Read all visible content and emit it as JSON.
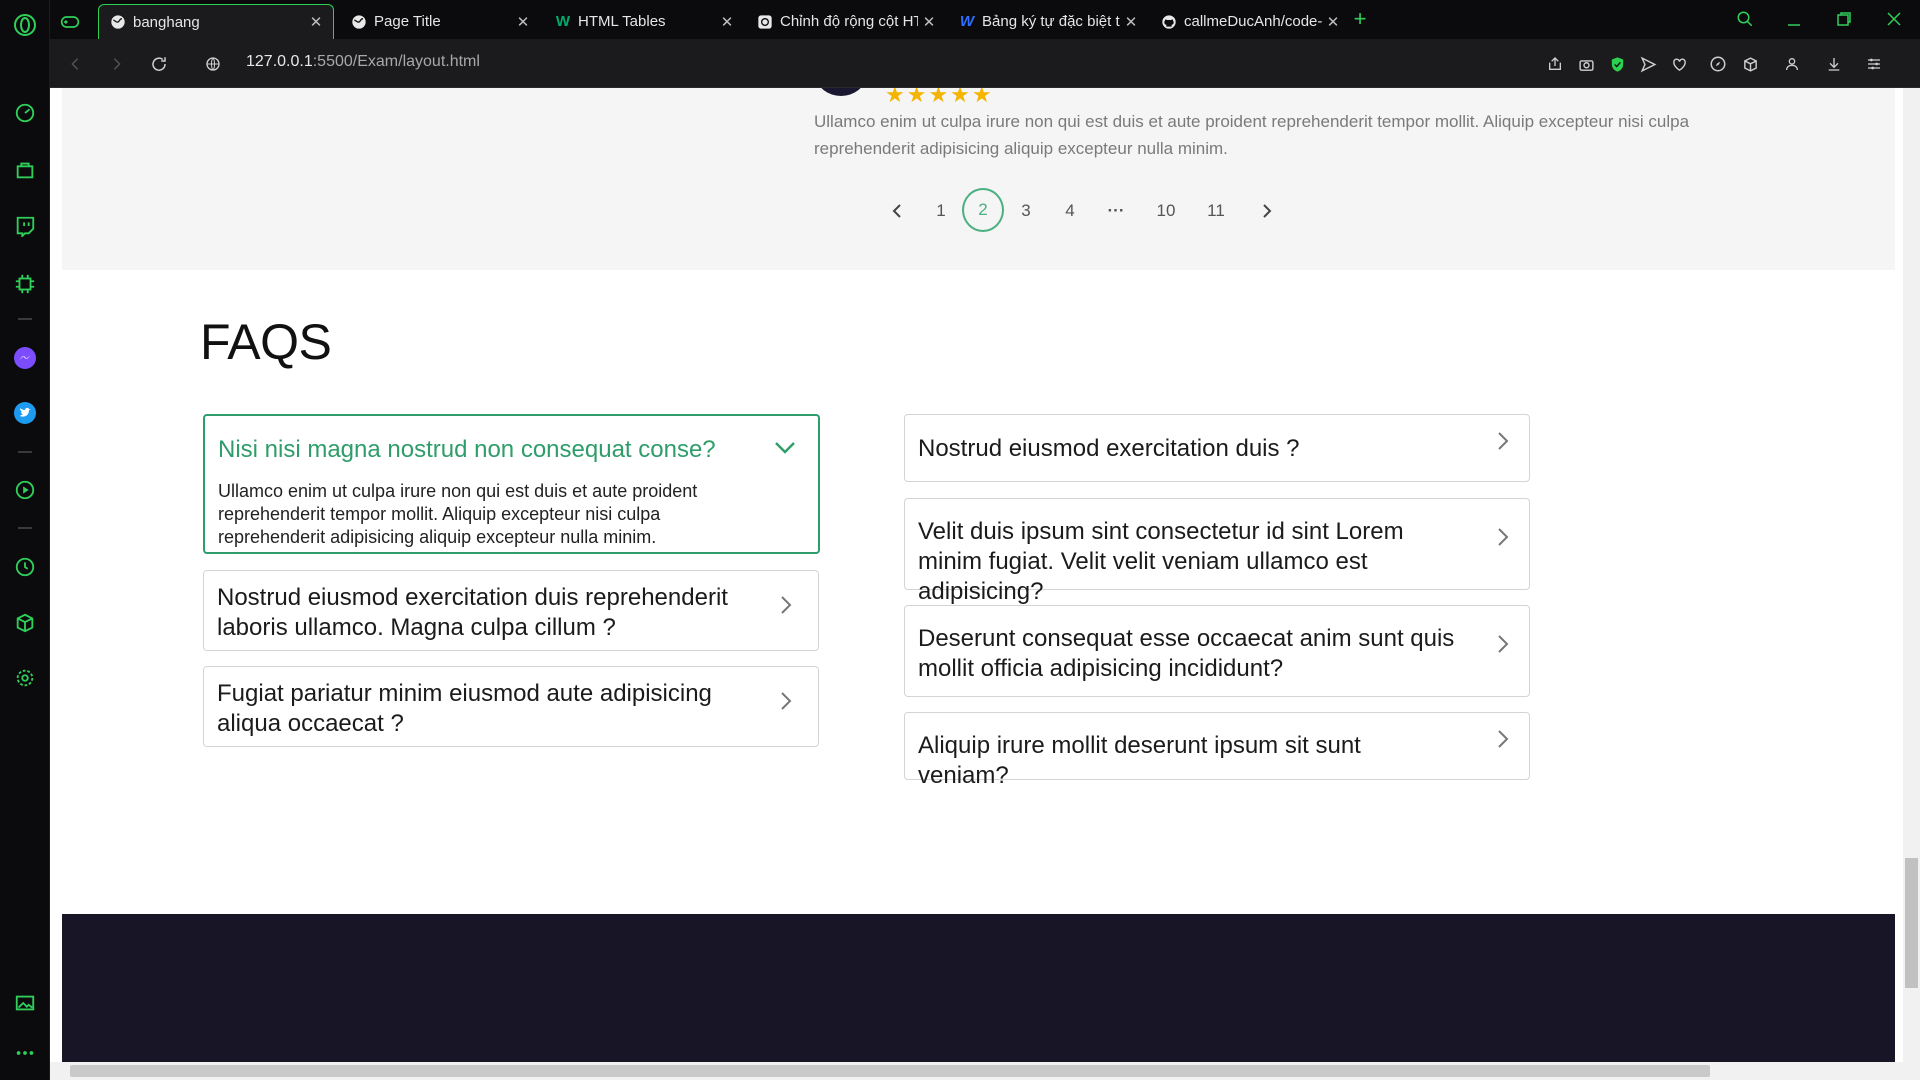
{
  "tabs": [
    {
      "title": "banghang",
      "active": true
    },
    {
      "title": "Page Title"
    },
    {
      "title": "HTML Tables"
    },
    {
      "title": "Chỉnh độ rộng cột HTML."
    },
    {
      "title": "Bảng ký tự đặc biệt trong H"
    },
    {
      "title": "callmeDucAnh/code-web"
    }
  ],
  "address": {
    "host": "127.0.0.1",
    "path": ":5500/Exam/layout.html"
  },
  "review": {
    "rating_stars": "★★★★★",
    "text": "Ullamco enim ut culpa irure non qui est duis et aute proident reprehenderit tempor mollit. Aliquip excepteur nisi culpa reprehenderit adipisicing aliquip excepteur nulla minim."
  },
  "pagination": {
    "pages": [
      "1",
      "2",
      "3",
      "4",
      "···",
      "10",
      "11"
    ],
    "current": "2"
  },
  "faqs": {
    "title": "FAQS",
    "left": [
      {
        "question": "Nisi nisi magna nostrud non consequat conse?",
        "answer": "Ullamco enim ut culpa irure non qui est duis et aute proident reprehenderit tempor mollit. Aliquip excepteur nisi culpa reprehenderit adipisicing aliquip excepteur nulla minim.",
        "open": true
      },
      {
        "question": "Nostrud eiusmod exercitation duis reprehenderit laboris ullamco. Magna culpa cillum ?"
      },
      {
        "question": "Fugiat pariatur minim eiusmod aute adipisicing aliqua occaecat ?"
      }
    ],
    "right": [
      {
        "question": "Nostrud eiusmod exercitation duis ?"
      },
      {
        "question": "Velit duis ipsum sint consectetur id sint Lorem minim fugiat. Velit velit veniam ullamco est adipisicing?"
      },
      {
        "question": "Deserunt consequat esse occaecat anim sunt quis mollit officia adipisicing incididunt?"
      },
      {
        "question": "Aliquip irure mollit deserunt ipsum sit sunt veniam?"
      }
    ]
  },
  "colors": {
    "accent": "#2f9d6a",
    "browser_accent": "#2bd24f",
    "footer": "#171526",
    "stars": "#f5b400"
  }
}
